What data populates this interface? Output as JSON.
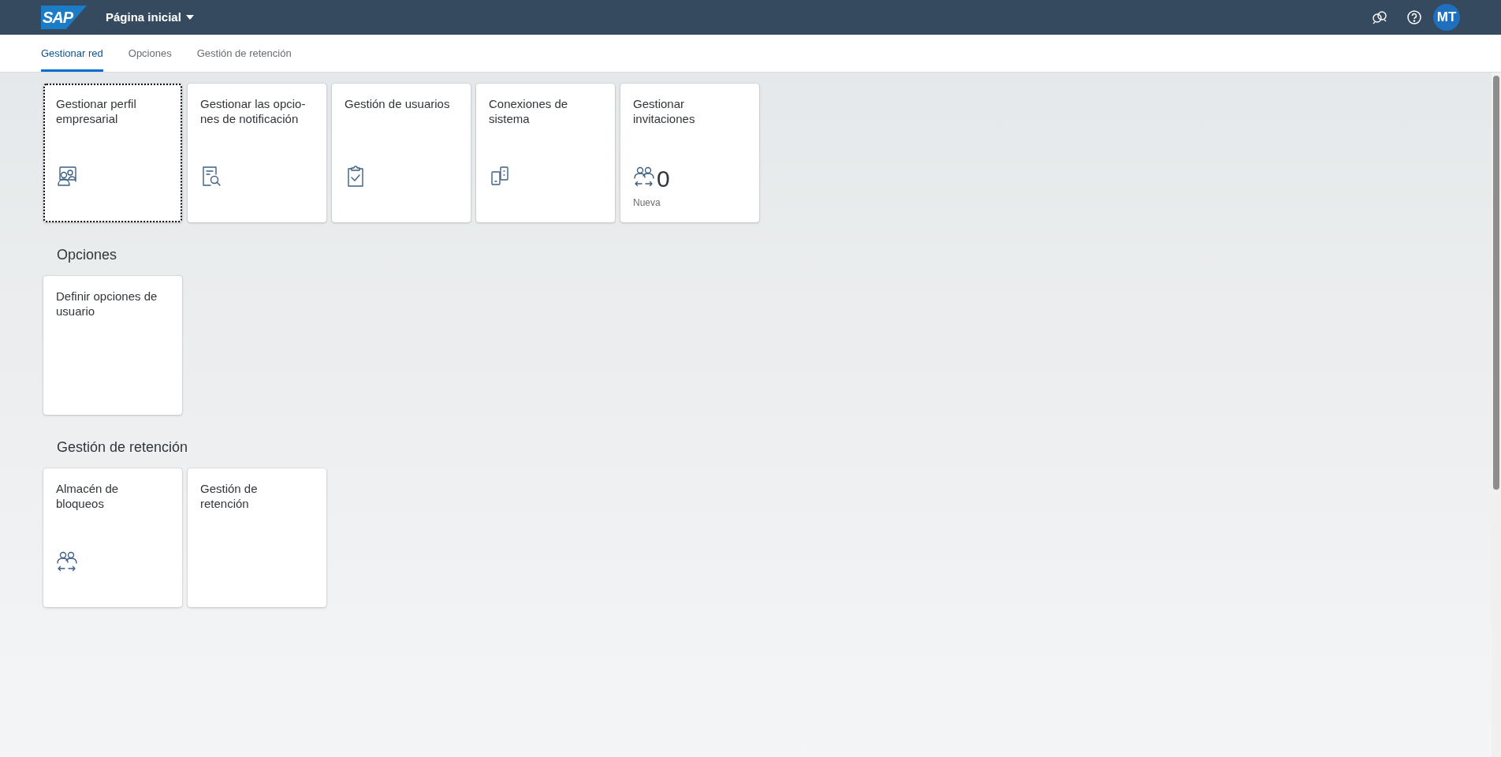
{
  "shell": {
    "logo": "SAP",
    "title": "Página inicial",
    "avatar": "MT"
  },
  "tabs": [
    {
      "label": "Gestionar red",
      "selected": true
    },
    {
      "label": "Opciones",
      "selected": false
    },
    {
      "label": "Gestión de retención",
      "selected": false
    }
  ],
  "sections": [
    {
      "tiles": [
        {
          "title": "Gestionar perfil empresarial",
          "kind": "profile",
          "focused": true
        },
        {
          "title": "Gestionar las opcio-\nnes de notificación",
          "kind": "notification",
          "focused": false
        },
        {
          "title": "Gestión de usuarios",
          "kind": "clipboard",
          "focused": false
        },
        {
          "title": "Conexiones de sistema",
          "kind": "devices",
          "focused": false
        },
        {
          "title": "Gestionar invitaciones",
          "kind": "people",
          "focused": false,
          "count": "0",
          "footer": "Nueva"
        }
      ]
    },
    {
      "title": "Opciones",
      "tiles": [
        {
          "title": "Definir opciones de usuario",
          "focused": false
        }
      ]
    },
    {
      "title": "Gestión de retención",
      "tiles": [
        {
          "title": "Almacén de bloqueos",
          "kind": "people",
          "focused": false
        },
        {
          "title": "Gestión de retención",
          "focused": false
        }
      ]
    }
  ]
}
